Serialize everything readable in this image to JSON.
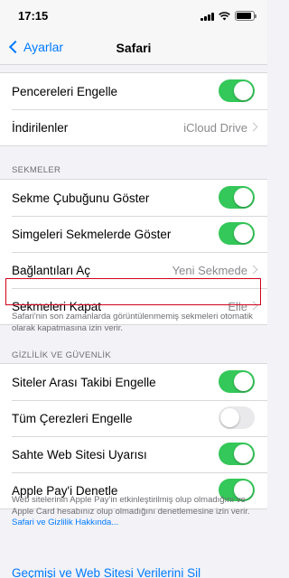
{
  "status_bar": {
    "time": "17:15",
    "battery_level": 0.9
  },
  "nav": {
    "back_label": "Ayarlar",
    "title": "Safari"
  },
  "general": {
    "rows": [
      {
        "label": "Pencereleri Engelle",
        "toggle": true
      },
      {
        "label": "İndirilenler",
        "value": "iCloud Drive"
      }
    ]
  },
  "tabs": {
    "header": "SEKMELER",
    "rows": [
      {
        "label": "Sekme Çubuğunu Göster",
        "toggle": true
      },
      {
        "label": "Simgeleri Sekmelerde Göster",
        "toggle": true
      },
      {
        "label": "Bağlantıları Aç",
        "value": "Yeni Sekmede"
      },
      {
        "label": "Sekmeleri Kapat",
        "value": "Elle"
      }
    ],
    "footer": "Safari'nin son zamanlarda görüntülenmemiş sekmeleri otomatik olarak kapatmasına izin verir."
  },
  "privacy": {
    "header": "GİZLİLİK VE GÜVENLİK",
    "rows": [
      {
        "label": "Siteler Arası Takibi Engelle",
        "toggle": true
      },
      {
        "label": "Tüm Çerezleri Engelle",
        "toggle": false
      },
      {
        "label": "Sahte Web Sitesi Uyarısı",
        "toggle": true
      },
      {
        "label": "Apple Pay'i Denetle",
        "toggle": true
      }
    ],
    "footer": "Web sitelerinin Apple Pay'in etkinleştirilmiş olup olmadığını ve Apple Card hesabınız olup olmadığını denetlemesine izin verir.",
    "footer_link": "Safari ve Gizlilik Hakkında..."
  },
  "bottom_link": "Geçmişi ve Web Sitesi Verilerini Sil",
  "colors": {
    "accent": "#007aff",
    "toggle_on": "#34c759",
    "highlight": "#d0021b"
  }
}
